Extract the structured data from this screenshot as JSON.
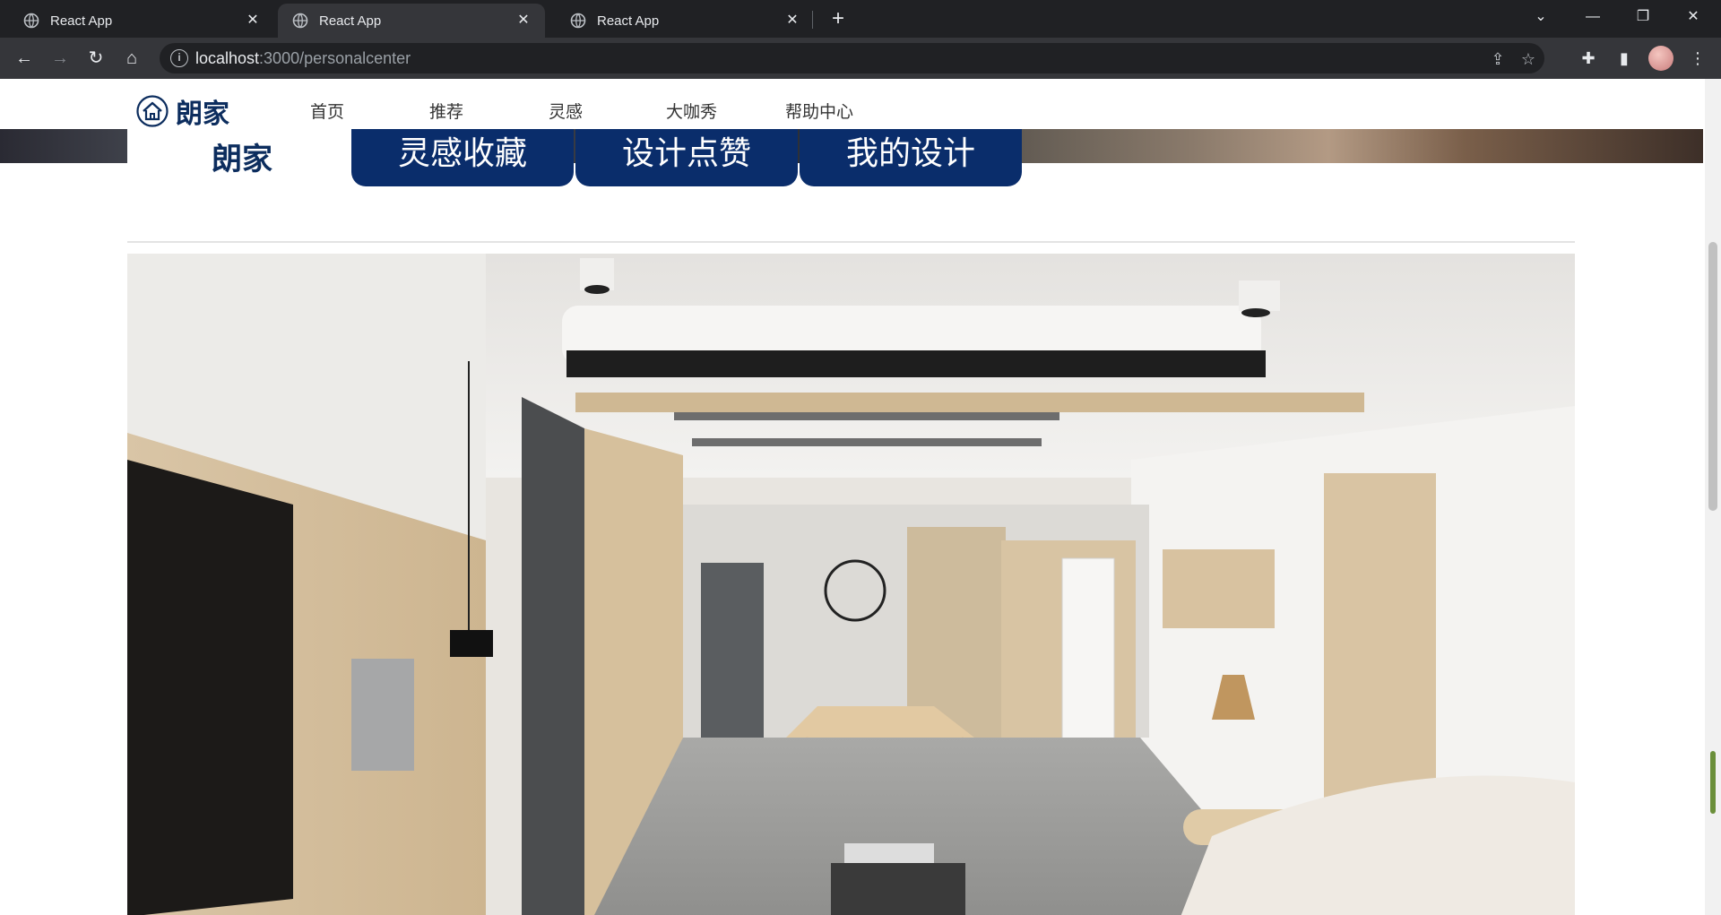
{
  "browser": {
    "tabs": [
      {
        "title": "React App",
        "active": false
      },
      {
        "title": "React App",
        "active": true
      },
      {
        "title": "React App",
        "active": false
      }
    ],
    "url_host": "localhost",
    "url_rest": ":3000/personalcenter"
  },
  "site": {
    "brand": "朗家",
    "nav": [
      "首页",
      "推荐",
      "灵感",
      "大咖秀",
      "帮助中心"
    ],
    "sub_brand": "朗家",
    "tabs": [
      "灵感收藏",
      "设计点赞",
      "我的设计"
    ]
  },
  "colors": {
    "brand_navy": "#0a2d6b",
    "chrome_dark": "#202124",
    "chrome_toolbar": "#35363a"
  }
}
